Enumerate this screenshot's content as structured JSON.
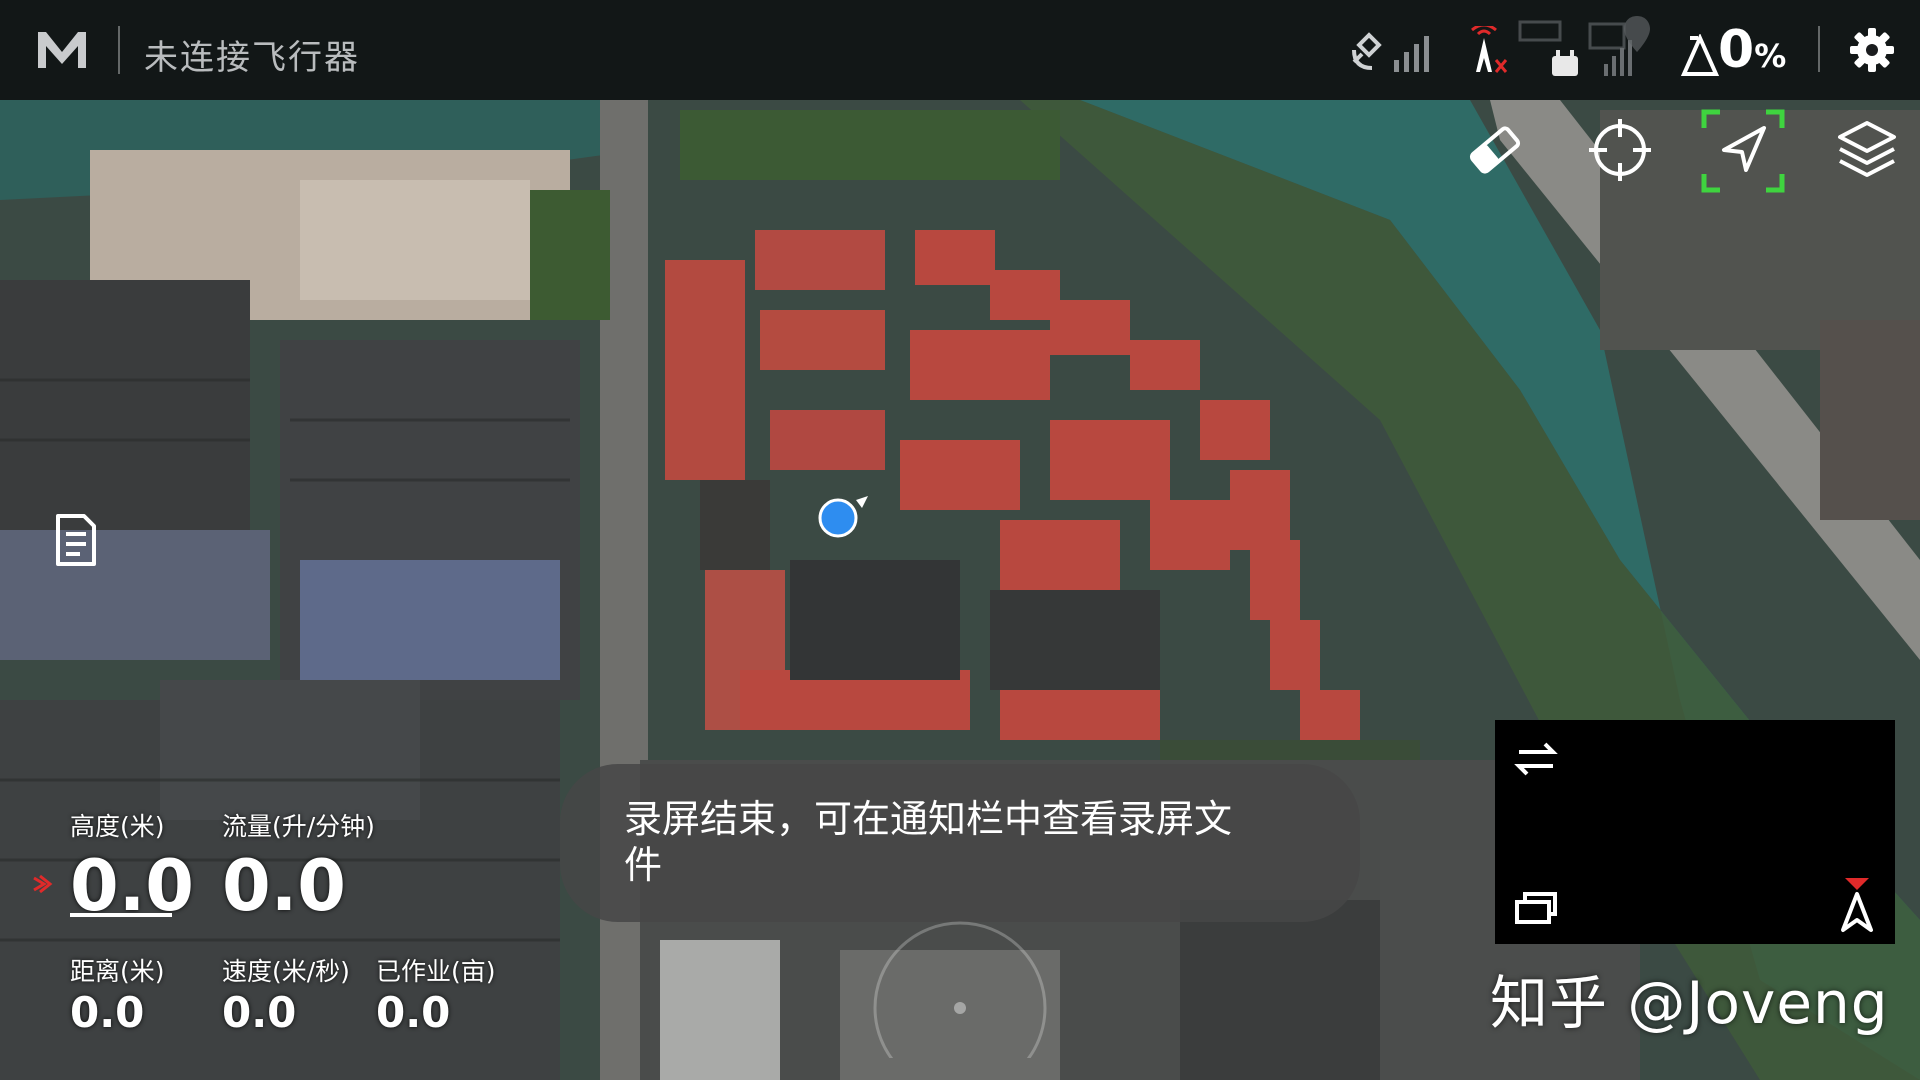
{
  "status_bar": {
    "title": "未连接飞行器",
    "battery_value": "0",
    "battery_unit": "%"
  },
  "tools": [
    "eraser-icon",
    "crosshair-icon",
    "locate-arrow-icon",
    "layers-icon"
  ],
  "telemetry": {
    "altitude_label": "高度(米)",
    "altitude_value": "0.0",
    "flow_label": "流量(升/分钟)",
    "flow_value": "0.0",
    "distance_label": "距离(米)",
    "distance_value": "0.0",
    "speed_label": "速度(米/秒)",
    "speed_value": "0.0",
    "area_label": "已作业(亩)",
    "area_value": "0.0"
  },
  "toast": {
    "message": "录屏结束，可在通知栏中查看录屏文件"
  },
  "watermark": "知乎 @Joveng",
  "colors": {
    "accent_green": "#3fd43f",
    "position_dot": "#2e8df0",
    "signal_red": "#e02a2a"
  }
}
